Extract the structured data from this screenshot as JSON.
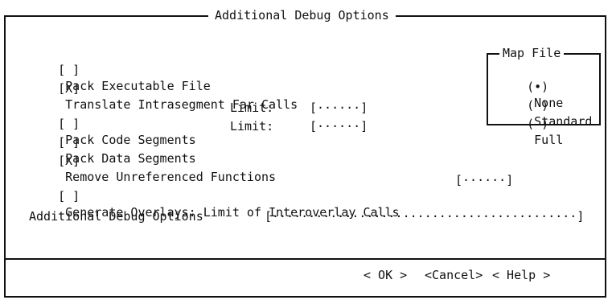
{
  "dialog": {
    "title": "Additional Debug Options",
    "options": {
      "pack_exe": {
        "check": "[ ]",
        "label": "Pack Executable File"
      },
      "translate": {
        "check": "[X]",
        "label": "Translate Intrasegment Far Calls"
      },
      "pack_code": {
        "check": "[ ]",
        "label": "Pack Code Segments",
        "limit_label": "Limit:",
        "limit_field": "[······]"
      },
      "pack_data": {
        "check": "[ ]",
        "label": "Pack Data Segments",
        "limit_label": "Limit:",
        "limit_field": "[······]"
      },
      "remove_unref": {
        "check": "[X]",
        "label": "Remove Unreferenced Functions"
      },
      "overlays": {
        "check": "[ ]",
        "label": "Generate Overlays: Limit of Interoverlay Calls",
        "field": "[······]"
      }
    },
    "map_file": {
      "title": "Map File",
      "options": [
        {
          "radio": "(•)",
          "label": "None"
        },
        {
          "radio": "( )",
          "label": "Standard"
        },
        {
          "radio": "( )",
          "label": "Full"
        }
      ]
    },
    "debug_options": {
      "label": "Additional Debug Options",
      "field": "[··········································]"
    },
    "buttons": {
      "ok": "< OK >",
      "cancel": "<Cancel>",
      "help": "< Help >"
    }
  }
}
